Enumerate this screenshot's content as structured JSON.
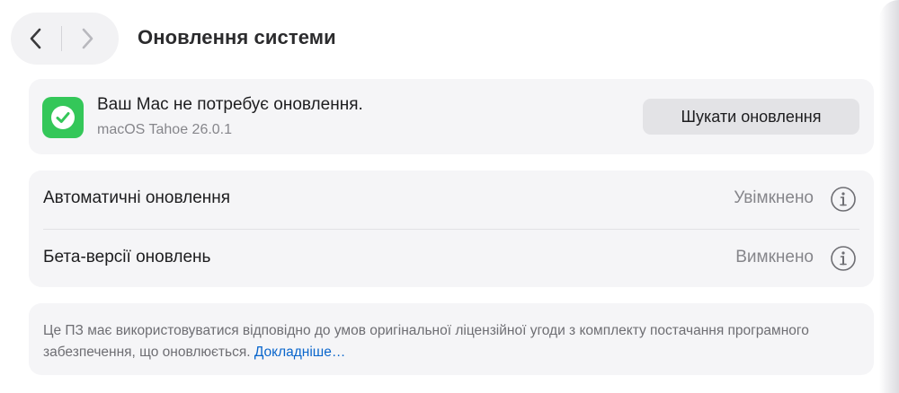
{
  "toolbar": {
    "back_icon": "chevron-left-icon",
    "forward_icon": "chevron-right-icon",
    "title": "Оновлення системи"
  },
  "status": {
    "icon": "checkmark-icon",
    "icon_color": "#34c759",
    "message": "Ваш Mac не потребує оновлення.",
    "version": "macOS Tahoe 26.0.1",
    "check_button_label": "Шукати оновлення"
  },
  "settings": {
    "rows": [
      {
        "label": "Автоматичні оновлення",
        "value": "Увімкнено",
        "icon": "info-icon"
      },
      {
        "label": "Бета-версії оновлень",
        "value": "Вимкнено",
        "icon": "info-icon"
      }
    ]
  },
  "license": {
    "text": "Це ПЗ має використовуватися відповідно до умов оригінальної ліцензійної угоди з комплекту постачання програмного забезпечення, що оновлюється.",
    "link_label": "Докладніше…",
    "link_color": "#0a66cc"
  }
}
